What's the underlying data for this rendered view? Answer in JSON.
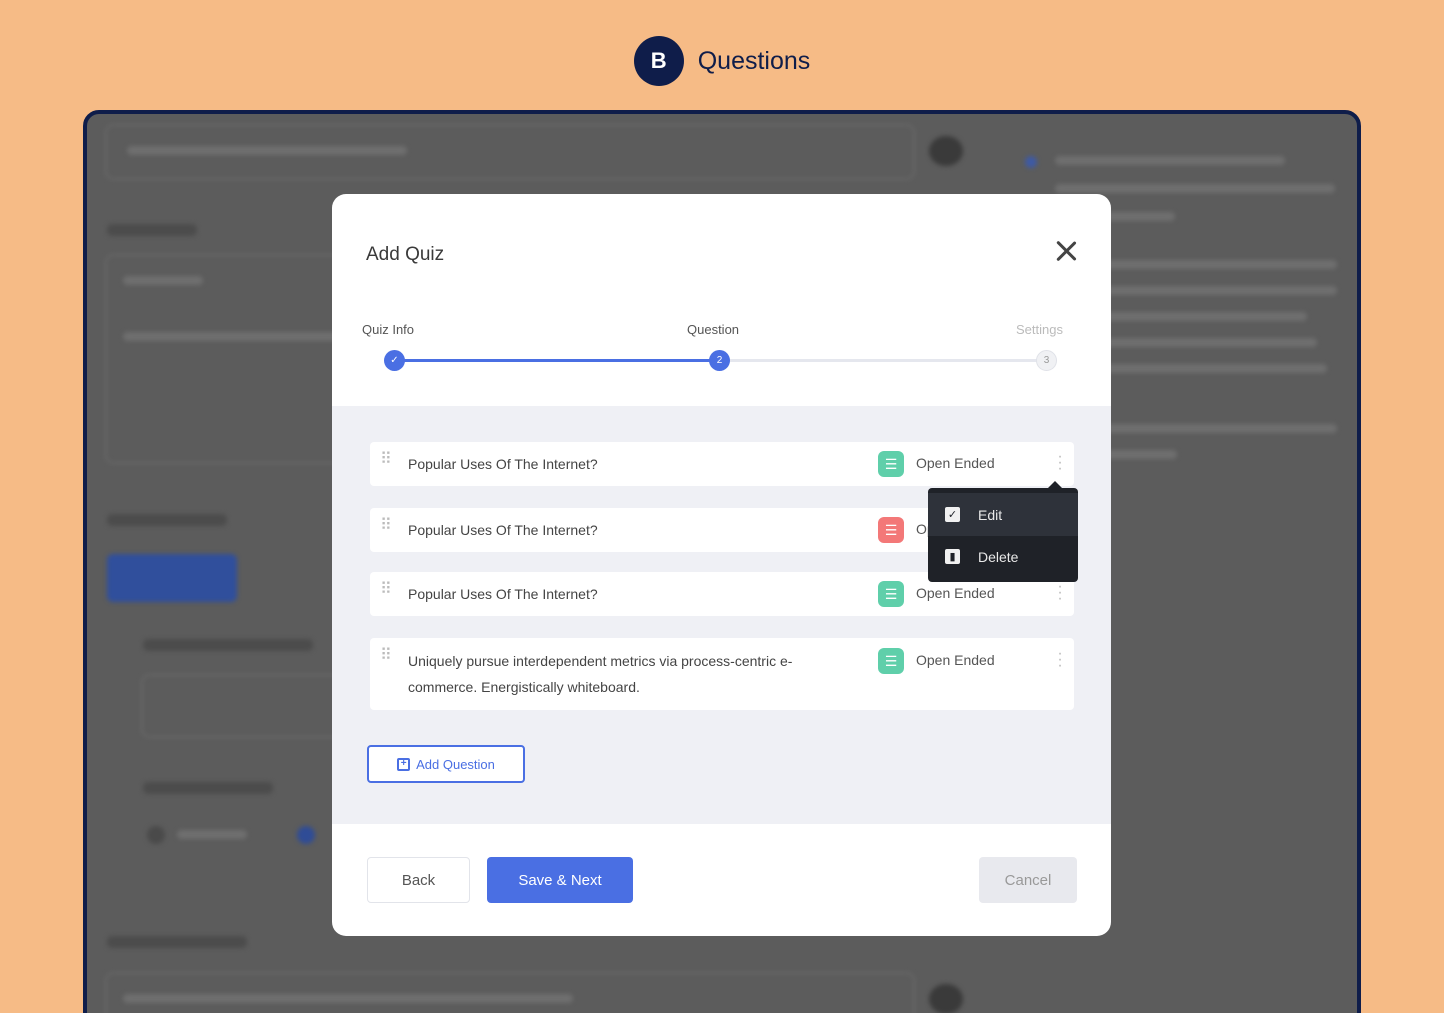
{
  "banner": {
    "badge_letter": "B",
    "title": "Questions"
  },
  "modal": {
    "title": "Add Quiz",
    "steps": [
      {
        "label": "Quiz Info",
        "number": "1",
        "state": "done"
      },
      {
        "label": "Question",
        "number": "2",
        "state": "active"
      },
      {
        "label": "Settings",
        "number": "3",
        "state": "inactive"
      }
    ],
    "questions": [
      {
        "text": "Popular Uses Of The Internet?",
        "type": "Open Ended",
        "type_color": "#5fcfaa"
      },
      {
        "text": "Popular Uses Of The Internet?",
        "type": "Open Ended",
        "type_color": "#f37878"
      },
      {
        "text": "Popular Uses Of The Internet?",
        "type": "Open Ended",
        "type_color": "#5fcfaa"
      },
      {
        "text": "Uniquely pursue interdependent metrics via process-centric e-commerce. Energistically whiteboard.",
        "type": "Open Ended",
        "type_color": "#5fcfaa"
      }
    ],
    "context_menu": {
      "edit": "Edit",
      "delete": "Delete"
    },
    "add_question": "Add Question",
    "back": "Back",
    "save_next": "Save & Next",
    "cancel": "Cancel"
  },
  "colors": {
    "accent": "#4a6fe3",
    "badge": "#0f1d4a",
    "page_bg": "#f6bb86"
  }
}
